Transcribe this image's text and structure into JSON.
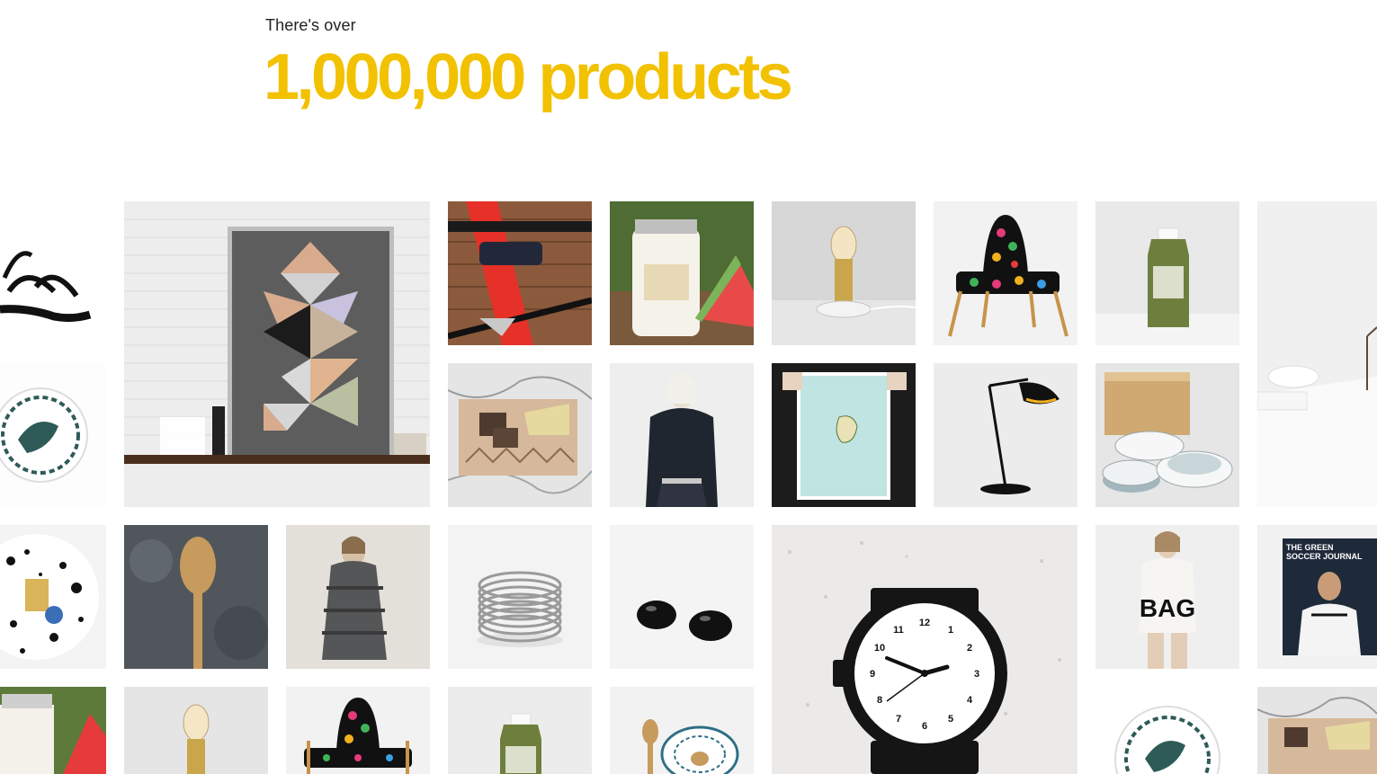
{
  "hero": {
    "kicker": "There's over",
    "headline": "1,000,000 products"
  },
  "colors": {
    "accent": "#f2c100",
    "text": "#222222",
    "background": "#ffffff"
  },
  "grid": {
    "items": [
      {
        "name": "sandals"
      },
      {
        "name": "plate-bird"
      },
      {
        "name": "dotted-plate"
      },
      {
        "name": "melon-jar-small"
      },
      {
        "name": "tangram-poster"
      },
      {
        "name": "wooden-spoon"
      },
      {
        "name": "edison-bulb"
      },
      {
        "name": "coat-model"
      },
      {
        "name": "chair-small"
      },
      {
        "name": "bike-wine-holder"
      },
      {
        "name": "cheese-board"
      },
      {
        "name": "silver-bangles"
      },
      {
        "name": "bottle-small"
      },
      {
        "name": "melon-head-jar"
      },
      {
        "name": "leather-jacket"
      },
      {
        "name": "black-stones"
      },
      {
        "name": "spoon-bowl"
      },
      {
        "name": "marble-lamp"
      },
      {
        "name": "map-print"
      },
      {
        "name": "wrist-watch"
      },
      {
        "name": "patterned-chair"
      },
      {
        "name": "black-desk-lamp"
      },
      {
        "name": "green-bottle"
      },
      {
        "name": "enamel-prep-set"
      },
      {
        "name": "sweater-model"
      },
      {
        "name": "plate-bird-small"
      },
      {
        "name": "white-interior"
      },
      {
        "name": "soccer-journal"
      },
      {
        "name": "cheese-board-small"
      }
    ]
  }
}
